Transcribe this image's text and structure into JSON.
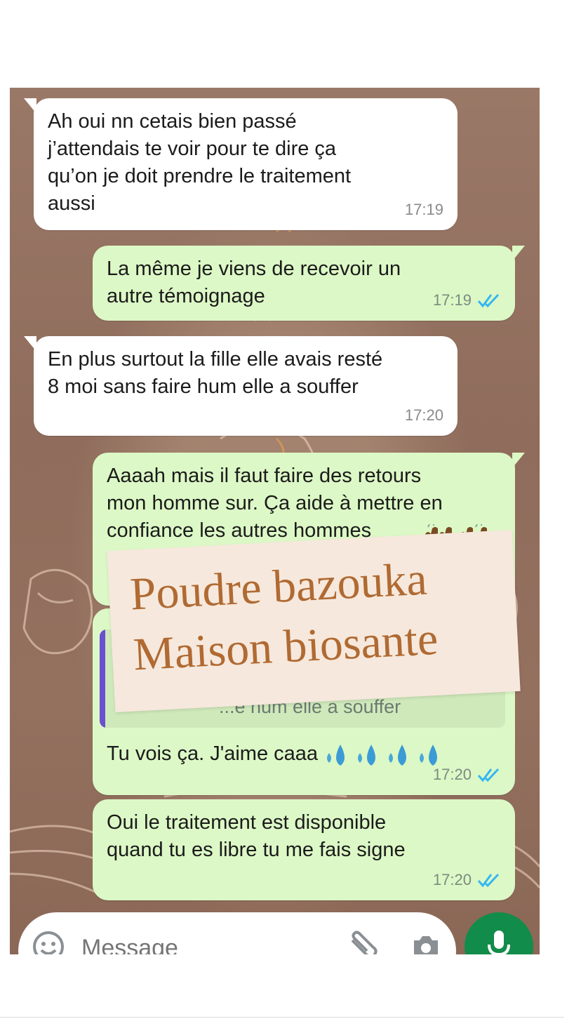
{
  "messages": [
    {
      "direction": "incoming",
      "text": "Ah oui nn cetais bien passé\nj’attendais te voir pour te dire ça\nqu’on je doit prendre le traitement\naussi",
      "time": "17:19"
    },
    {
      "direction": "outgoing",
      "text": "La même je viens de recevoir un\nautre témoignage",
      "time": "17:19",
      "read": true
    },
    {
      "direction": "incoming",
      "text": "En plus surtout la fille elle avais resté\n8 moi sans faire hum elle a souffer",
      "time": "17:20"
    },
    {
      "direction": "outgoing",
      "text": "Aaaah mais il faut faire des retours\nmon homme sur. Ça aide à mettre en\nconfiance les autres hommes",
      "emoji": "raising-hands-and-folded-hands",
      "read": true
    },
    {
      "direction": "outgoing",
      "quote": "...e hum elle a souffer",
      "text": "Tu vois ça. J'aime caaa",
      "emoji": "sweat-droplets",
      "time": "17:20",
      "read": true
    },
    {
      "direction": "outgoing",
      "text": "Oui le traitement est disponible\nquand tu es libre tu me fais signe",
      "time": "17:20",
      "read": true
    }
  ],
  "watermark": {
    "line1": "Poudre bazouka",
    "line2": "Maison biosante"
  },
  "composer": {
    "placeholder": "Message"
  },
  "colors": {
    "outgoing_bubble": "#dcf8c6",
    "incoming_bubble": "#ffffff",
    "mic_button": "#128c4a",
    "read_ticks": "#34b7f1",
    "watermark_text": "#b06a32"
  }
}
